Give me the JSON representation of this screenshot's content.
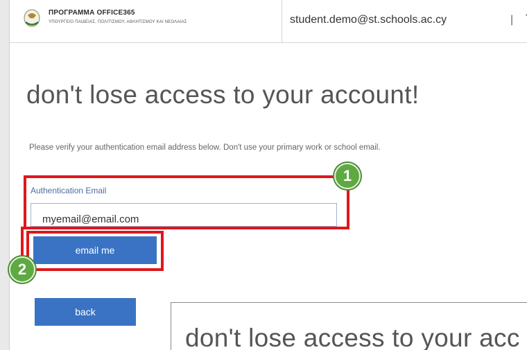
{
  "header": {
    "org_name": "ΠΡΟΓΡΑΜΜΑ OFFICE365",
    "org_subtitle": "ΥΠΟΥΡΓΕΙΟ ΠΑΙΔΕΙΑΣ, ΠΟΛΙΤΙΣΜΟΥ, ΑΘΛΗΤΙΣΜΟΥ ΚΑΙ ΝΕΟΛΑΙΑΣ",
    "user_email": "student.demo@st.schools.ac.cy",
    "separator": "|",
    "truncated_text": "T"
  },
  "main": {
    "title": "don't lose access to your account!",
    "description": "Please verify your authentication email address below. Don't use your primary work or school email.",
    "field_label": "Authentication Email",
    "email_value": "myemail@email.com",
    "email_button_label": "email me",
    "back_button_label": "back"
  },
  "annotations": {
    "step1": "1",
    "step2": "2"
  },
  "preview": {
    "title": "don't lose access to your acc"
  },
  "colors": {
    "button": "#3a73c4",
    "highlight": "#e0161b",
    "badge": "#5fa943"
  }
}
